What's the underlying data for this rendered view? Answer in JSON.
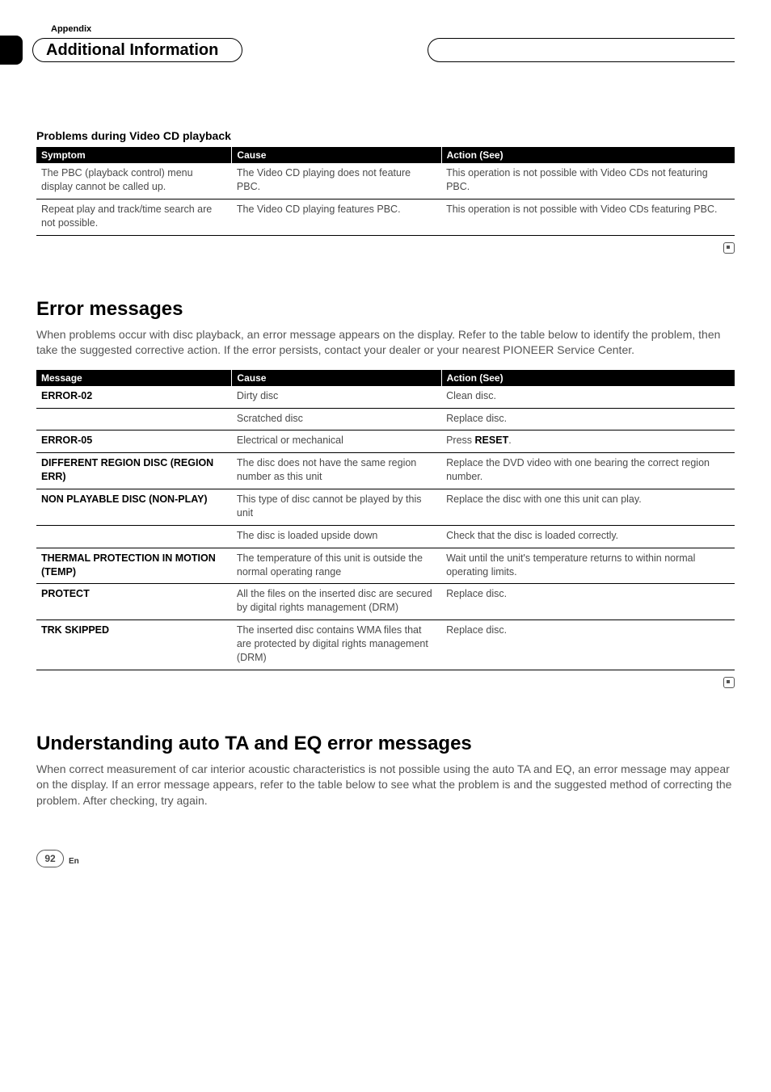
{
  "header": {
    "appendix_label": "Appendix",
    "pill_title": "Additional Information"
  },
  "section1": {
    "subtitle": "Problems during Video CD playback",
    "headers": [
      "Symptom",
      "Cause",
      "Action (See)"
    ],
    "rows": [
      {
        "c1": "The PBC (playback control) menu display cannot be called up.",
        "c2": "The Video CD playing does not feature PBC.",
        "c3": "This operation is not possible with Video CDs not featuring PBC."
      },
      {
        "c1": "Repeat play and track/time search are not possible.",
        "c2": "The Video CD playing features PBC.",
        "c3": "This operation is not possible with Video CDs featuring PBC."
      }
    ]
  },
  "section2": {
    "title": "Error messages",
    "intro": "When problems occur with disc playback, an error message appears on the display. Refer to the table below to identify the problem, then take the suggested corrective action. If the error persists, contact your dealer or your nearest PIONEER Service Center.",
    "headers": [
      "Message",
      "Cause",
      "Action (See)"
    ],
    "rows": [
      {
        "m": "ERROR-02",
        "c": "Dirty disc",
        "a": "Clean disc."
      },
      {
        "m": "",
        "c": "Scratched disc",
        "a": "Replace disc."
      },
      {
        "m": "ERROR-05",
        "c": "Electrical or mechanical",
        "a_prefix": "Press ",
        "a_bold": "RESET",
        "a_suffix": "."
      },
      {
        "m": "DIFFERENT REGION DISC (REGION ERR)",
        "c": "The disc does not have the same region number as this unit",
        "a": "Replace the DVD video with one bearing the correct region number."
      },
      {
        "m": "NON PLAYABLE DISC (NON-PLAY)",
        "c": "This type of disc cannot be played by this unit",
        "a": "Replace the disc with one this unit can play."
      },
      {
        "m": "",
        "c": "The disc is loaded upside down",
        "a": "Check that the disc is loaded correctly."
      },
      {
        "m": "THERMAL PROTECTION IN MOTION (TEMP)",
        "c": "The temperature of this unit is outside the normal operating range",
        "a": "Wait until the unit's temperature returns to within normal operating limits."
      },
      {
        "m": "PROTECT",
        "c": "All the files on the inserted disc are secured by digital rights management (DRM)",
        "a": "Replace disc."
      },
      {
        "m": "TRK SKIPPED",
        "c": "The inserted disc contains WMA files that are protected by digital rights management (DRM)",
        "a": "Replace disc."
      }
    ]
  },
  "section3": {
    "title": "Understanding auto TA and EQ error messages",
    "intro": "When correct measurement of car interior acoustic characteristics is not possible using the auto TA and EQ, an error message may appear on the display. If an error message appears, refer to the table below to see what the problem is and the suggested method of correcting the problem. After checking, try again."
  },
  "footer": {
    "page_number": "92",
    "language": "En"
  }
}
